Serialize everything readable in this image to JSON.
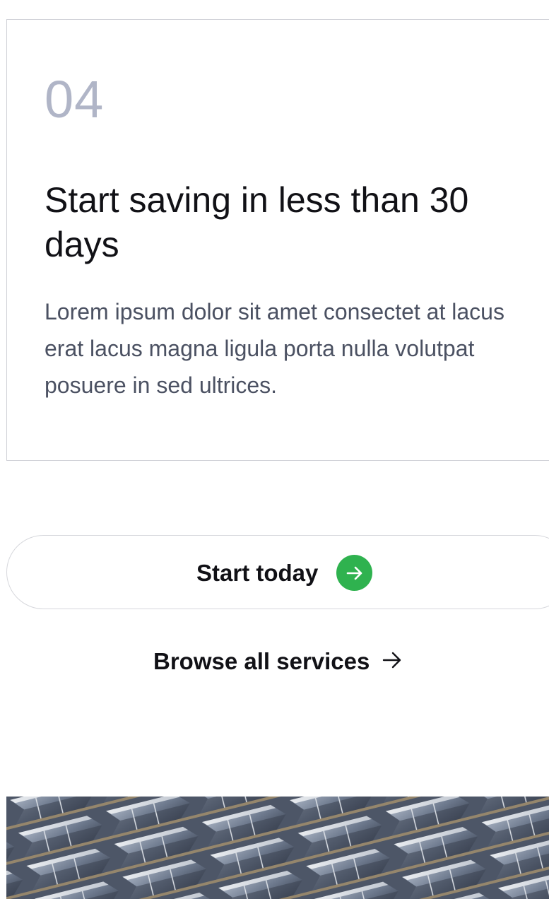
{
  "step_card": {
    "number": "04",
    "title": "Start saving in less than 30 days",
    "description": "Lorem ipsum dolor sit amet consectet at lacus erat lacus magna ligula porta nulla volutpat posuere in sed ultrices."
  },
  "cta": {
    "label": "Start today",
    "icon": "arrow-right-icon",
    "accent_color": "#2fb24f"
  },
  "browse_link": {
    "label": "Browse all services",
    "icon": "arrow-right-icon"
  },
  "image": {
    "subject": "building-facade"
  }
}
